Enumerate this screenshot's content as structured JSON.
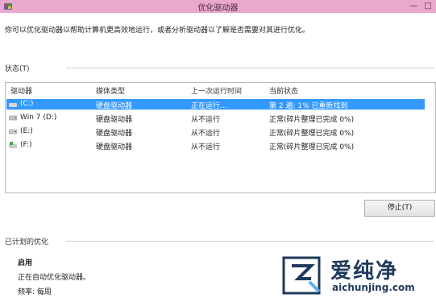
{
  "window": {
    "title": "优化驱动器",
    "colors": {
      "titlebar": "#e9a8cd",
      "selection": "#3399ff"
    }
  },
  "description": "你可以优化驱动器以帮助计算机更高效地运行，或者分析驱动器以了解是否需要对其进行优化。",
  "status": {
    "section_label": "状态(T)",
    "columns": [
      "驱动器",
      "媒体类型",
      "上一次运行时间",
      "当前状态"
    ],
    "rows": [
      {
        "drive": "(C:)",
        "media": "硬盘驱动器",
        "last_run": "正在运行...",
        "status": "第 2 遍: 1% 已重新找到",
        "icon": "windows-drive-icon",
        "selected": true
      },
      {
        "drive": "Win 7 (D:)",
        "media": "硬盘驱动器",
        "last_run": "从不运行",
        "status": "正常(碎片整理已完成 0%)",
        "icon": "hard-drive-icon",
        "selected": false
      },
      {
        "drive": "(E:)",
        "media": "硬盘驱动器",
        "last_run": "从不运行",
        "status": "正常(碎片整理已完成 0%)",
        "icon": "hard-drive-icon",
        "selected": false
      },
      {
        "drive": "(F:)",
        "media": "硬盘驱动器",
        "last_run": "从不运行",
        "status": "正常(碎片整理已完成 0%)",
        "icon": "green-drive-icon",
        "selected": false
      }
    ]
  },
  "buttons": {
    "stop": "停止(T)"
  },
  "scheduled": {
    "section_label": "已计划的优化",
    "state": "启用",
    "detail": "正在自动优化驱动器。",
    "frequency": "频率: 每周"
  },
  "watermark": {
    "brand": "爱纯净",
    "url": "aichunjing.com"
  }
}
